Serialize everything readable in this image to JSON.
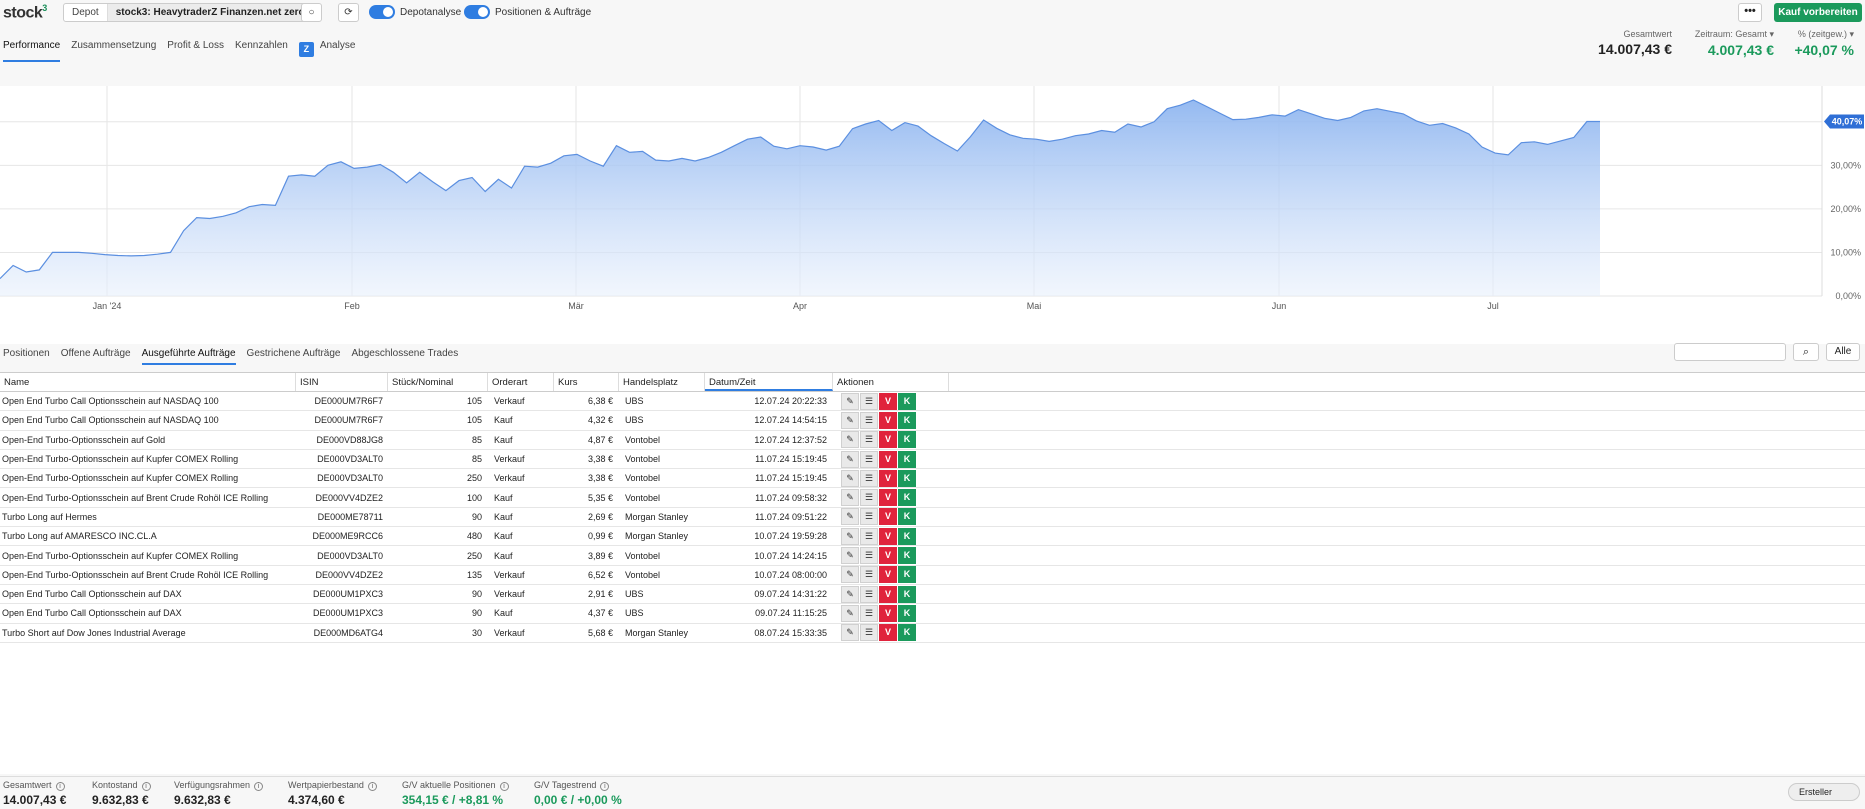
{
  "app": {
    "logo": "stock",
    "logo_sup": "3"
  },
  "header": {
    "depot_label": "Depot",
    "depot_value": "stock3: HeavytraderZ Finanzen.net zero",
    "toggle1": "Depotanalyse",
    "toggle2": "Positionen & Aufträge",
    "more": "•••",
    "buy": "Kauf vorbereiten"
  },
  "tabs": [
    "Performance",
    "Zusammensetzung",
    "Profit & Loss",
    "Kennzahlen",
    "Analyse"
  ],
  "kpis": {
    "total_label": "Gesamtwert",
    "total_value": "14.007,43 €",
    "period_label": "Zeitraum: Gesamt",
    "period_value": "4.007,43 €",
    "pct_label": "% (zeitgew.)",
    "pct_value": "+40,07 %"
  },
  "chart_data": {
    "type": "area",
    "x_tick_labels": [
      "Jan '24",
      "Feb",
      "Mär",
      "Apr",
      "Mai",
      "Jun",
      "Jul"
    ],
    "y_tick_labels": [
      "0,00%",
      "10,00%",
      "20,00%",
      "30,00%",
      "40,07%"
    ],
    "ylim": [
      0,
      45
    ],
    "current_label": "40,07%",
    "values": [
      4,
      7,
      5.5,
      6,
      10,
      10,
      10,
      9.8,
      9.5,
      9.3,
      9.2,
      9.3,
      9.6,
      10,
      15,
      18,
      17.8,
      18.3,
      19.1,
      20.5,
      21,
      20.8,
      27.5,
      27.8,
      27.5,
      30,
      30.8,
      29.3,
      29.6,
      30.2,
      28.4,
      26,
      28.4,
      26.2,
      24.2,
      26.5,
      27.2,
      24,
      26.8,
      24.8,
      29.8,
      29.6,
      30.5,
      32.2,
      32.5,
      31,
      29.8,
      34.5,
      33,
      33.2,
      31.2,
      31,
      31.6,
      31,
      31.8,
      33,
      34.5,
      36,
      36.5,
      34.4,
      33.8,
      34.5,
      34.2,
      33.5,
      34.4,
      38.4,
      39.5,
      40.3,
      38,
      39.8,
      39,
      36.8,
      35,
      33.3,
      36.6,
      40.4,
      38.5,
      37,
      36.2,
      36,
      35.5,
      36,
      36.8,
      37.2,
      38,
      37.6,
      39.5,
      38.8,
      40,
      43,
      43.8,
      45,
      43.5,
      42,
      40.5,
      40.6,
      41,
      41.6,
      41.3,
      42.8,
      41.8,
      40.8,
      40.3,
      41,
      42.5,
      43,
      42.4,
      41.8,
      40.2,
      39.2,
      39.6,
      38.6,
      37.2,
      34.2,
      32.8,
      32.4,
      35.2,
      35.4,
      34.8,
      35.6,
      36.4,
      40.07,
      40.07
    ]
  },
  "subtabs": [
    "Positionen",
    "Offene Aufträge",
    "Ausgeführte Aufträge",
    "Gestrichene Aufträge",
    "Abgeschlossene Trades"
  ],
  "filter_all": "Alle",
  "table": {
    "headers": [
      "Name",
      "ISIN",
      "Stück/Nominal",
      "Orderart",
      "Kurs",
      "Handelsplatz",
      "Datum/Zeit",
      "Aktionen"
    ],
    "rows": [
      [
        "Open End Turbo Call Optionsschein auf NASDAQ 100",
        "DE000UM7R6F7",
        "105",
        "Verkauf",
        "6,38 €",
        "UBS",
        "12.07.24 20:22:33"
      ],
      [
        "Open End Turbo Call Optionsschein auf NASDAQ 100",
        "DE000UM7R6F7",
        "105",
        "Kauf",
        "4,32 €",
        "UBS",
        "12.07.24 14:54:15"
      ],
      [
        "Open-End Turbo-Optionsschein auf Gold",
        "DE000VD88JG8",
        "85",
        "Kauf",
        "4,87 €",
        "Vontobel",
        "12.07.24 12:37:52"
      ],
      [
        "Open-End Turbo-Optionsschein auf Kupfer COMEX Rolling",
        "DE000VD3ALT0",
        "85",
        "Verkauf",
        "3,38 €",
        "Vontobel",
        "11.07.24 15:19:45"
      ],
      [
        "Open-End Turbo-Optionsschein auf Kupfer COMEX Rolling",
        "DE000VD3ALT0",
        "250",
        "Verkauf",
        "3,38 €",
        "Vontobel",
        "11.07.24 15:19:45"
      ],
      [
        "Open-End Turbo-Optionsschein auf Brent Crude Rohöl ICE Rolling",
        "DE000VV4DZE2",
        "100",
        "Kauf",
        "5,35 €",
        "Vontobel",
        "11.07.24 09:58:32"
      ],
      [
        "Turbo Long auf Hermes",
        "DE000ME78711",
        "90",
        "Kauf",
        "2,69 €",
        "Morgan Stanley",
        "11.07.24 09:51:22"
      ],
      [
        "Turbo Long auf AMARESCO INC.CL.A",
        "DE000ME9RCC6",
        "480",
        "Kauf",
        "0,99 €",
        "Morgan Stanley",
        "10.07.24 19:59:28"
      ],
      [
        "Open-End Turbo-Optionsschein auf Kupfer COMEX Rolling",
        "DE000VD3ALT0",
        "250",
        "Kauf",
        "3,89 €",
        "Vontobel",
        "10.07.24 14:24:15"
      ],
      [
        "Open-End Turbo-Optionsschein auf Brent Crude Rohöl ICE Rolling",
        "DE000VV4DZE2",
        "135",
        "Verkauf",
        "6,52 €",
        "Vontobel",
        "10.07.24 08:00:00"
      ],
      [
        "Open End Turbo Call Optionsschein auf DAX",
        "DE000UM1PXC3",
        "90",
        "Verkauf",
        "2,91 €",
        "UBS",
        "09.07.24 14:31:22"
      ],
      [
        "Open End Turbo Call Optionsschein auf DAX",
        "DE000UM1PXC3",
        "90",
        "Kauf",
        "4,37 €",
        "UBS",
        "09.07.24 11:15:25"
      ],
      [
        "Turbo Short auf Dow Jones Industrial Average",
        "DE000MD6ATG4",
        "30",
        "Verkauf",
        "5,68 €",
        "Morgan Stanley",
        "08.07.24 15:33:35"
      ]
    ],
    "action_v": "V",
    "action_k": "K"
  },
  "footer": {
    "stats": [
      {
        "label": "Gesamtwert",
        "value": "14.007,43 €",
        "green": false
      },
      {
        "label": "Kontostand",
        "value": "9.632,83 €",
        "green": false
      },
      {
        "label": "Verfügungsrahmen",
        "value": "9.632,83 €",
        "green": false
      },
      {
        "label": "Wertpapierbestand",
        "value": "4.374,60 €",
        "green": false
      },
      {
        "label": "G/V aktuelle Positionen",
        "value": "354,15 € / +8,81 %",
        "green": true
      },
      {
        "label": "G/V Tagestrend",
        "value": "0,00 € / +0,00 %",
        "green": true
      }
    ],
    "ersteller": "Ersteller"
  },
  "colors": {
    "accent": "#2f7de1",
    "buy": "#1b9a5c",
    "sell": "#e0233c"
  }
}
